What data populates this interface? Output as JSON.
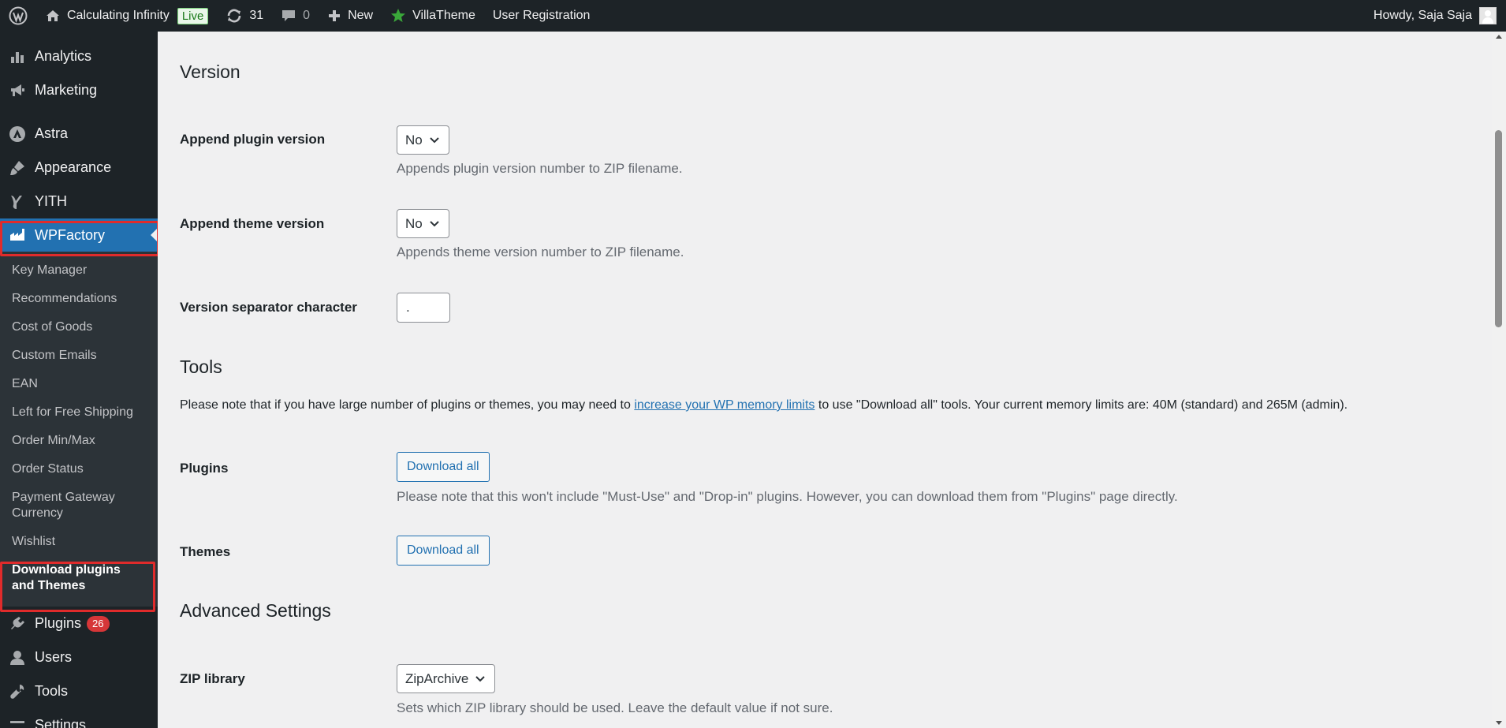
{
  "adminbar": {
    "site_name": "Calculating Infinity",
    "live_badge": "Live",
    "updates_count": "31",
    "comments_count": "0",
    "new_label": "New",
    "villatheme_label": "VillaTheme",
    "user_registration_label": "User Registration",
    "howdy": "Howdy, Saja Saja"
  },
  "sidebar": {
    "items_top": [
      {
        "label": "Analytics",
        "icon": "bar-chart-icon"
      },
      {
        "label": "Marketing",
        "icon": "megaphone-icon"
      },
      {
        "label": "Astra",
        "icon": "astra-icon"
      },
      {
        "label": "Appearance",
        "icon": "paintbrush-icon"
      },
      {
        "label": "YITH",
        "icon": "yith-icon"
      }
    ],
    "active_item": {
      "label": "WPFactory",
      "icon": "wpfactory-icon"
    },
    "submenu": [
      "Key Manager",
      "Recommendations",
      "Cost of Goods",
      "Custom Emails",
      "EAN",
      "Left for Free Shipping",
      "Order Min/Max",
      "Order Status",
      "Payment Gateway Currency",
      "Wishlist"
    ],
    "current_submenu": "Download plugins and Themes",
    "items_bottom": [
      {
        "label": "Plugins",
        "icon": "plugin-icon",
        "badge": "26"
      },
      {
        "label": "Users",
        "icon": "user-icon"
      },
      {
        "label": "Tools",
        "icon": "wrench-icon"
      },
      {
        "label": "Settings",
        "icon": "settings-icon"
      }
    ]
  },
  "content": {
    "version_heading": "Version",
    "append_plugin_label": "Append plugin version",
    "append_plugin_value": "No",
    "append_plugin_desc": "Appends plugin version number to ZIP filename.",
    "append_theme_label": "Append theme version",
    "append_theme_value": "No",
    "append_theme_desc": "Appends theme version number to ZIP filename.",
    "separator_label": "Version separator character",
    "separator_value": ".",
    "tools_heading": "Tools",
    "tools_note_before": "Please note that if you have large number of plugins or themes, you may need to ",
    "tools_note_link": "increase your WP memory limits",
    "tools_note_after": " to use \"Download all\" tools. Your current memory limits are: 40M (standard) and 265M (admin).",
    "plugins_label": "Plugins",
    "plugins_button": "Download all",
    "plugins_desc": "Please note that this won't include \"Must-Use\" and \"Drop-in\" plugins. However, you can download them from \"Plugins\" page directly.",
    "themes_label": "Themes",
    "themes_button": "Download all",
    "advanced_heading": "Advanced Settings",
    "zip_label": "ZIP library",
    "zip_value": "ZipArchive",
    "zip_desc": "Sets which ZIP library should be used. Leave the default value if not sure."
  },
  "colors": {
    "accent": "#2271b1",
    "highlight": "#e02b2b",
    "adminbar_bg": "#1d2327"
  }
}
